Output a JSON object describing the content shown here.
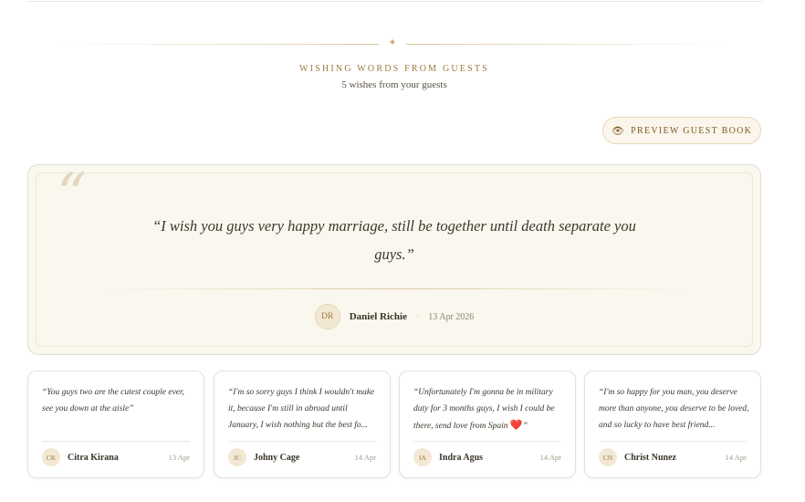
{
  "section": {
    "title": "WISHING WORDS FROM GUESTS",
    "subtitle": "5 wishes from your guests",
    "preview_button": "PREVIEW GUEST BOOK",
    "preview_icon": "eye-icon"
  },
  "featured": {
    "quote_mark": "“",
    "message": "“I wish you guys very happy marriage, still be together until death separate you guys.”",
    "initials": "DR",
    "name": "Daniel Richie",
    "separator": "·",
    "date": "13 Apr 2026"
  },
  "wishes": [
    {
      "message": "“You guys two are the cutest couple ever, see you down at the aisle”",
      "initials": "CK",
      "name": "Citra Kirana",
      "date": "13 Apr"
    },
    {
      "message": "“I'm so sorry guys I think I wouldn't make it, because I'm still in abroad until January, I wish nothing but the best fo...",
      "initials": "JC",
      "name": "Johny Cage",
      "date": "14 Apr"
    },
    {
      "message": "“Unfortunately I'm gonna be in military duty for 3 months guys, I wish I could be there, send love from Spain",
      "heart": "❤️",
      "end_quote": "”",
      "initials": "IA",
      "name": "Indra Agus",
      "date": "14 Apr"
    },
    {
      "message": "“I'm so happy for you man, you deserve more than anyone, you deserve to be loved, and so lucky to have best friend...",
      "initials": "CN",
      "name": "Christ Nunez",
      "date": "14 Apr"
    }
  ],
  "colors": {
    "accent": "#9a7a3d",
    "featured_bg": "#f9f7ee",
    "heart": "#d63a3a"
  }
}
